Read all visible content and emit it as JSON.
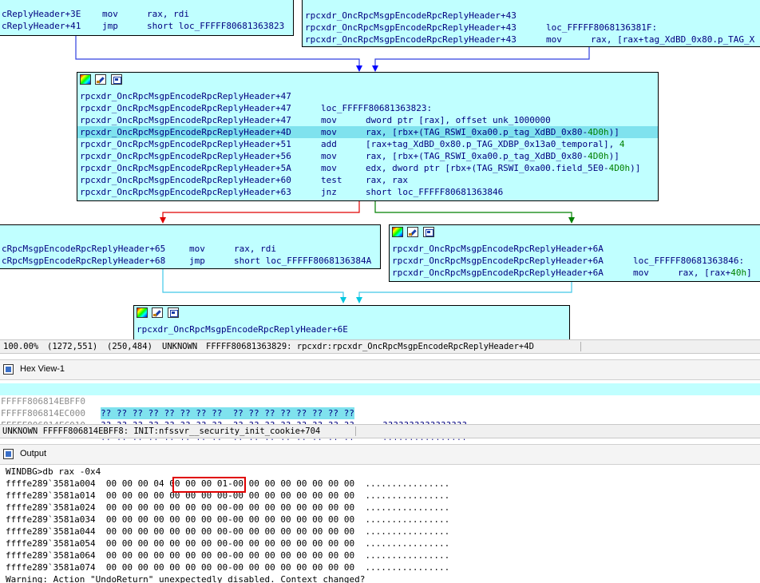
{
  "graph": {
    "node_top_left": [
      {
        "label": "cReplyHeader+3E",
        "mnem": "mov",
        "ops": "rax, rdi"
      },
      {
        "label": "cReplyHeader+41",
        "mnem": "jmp",
        "ops": "short loc_FFFFF80681363823"
      }
    ],
    "node_top_right": [
      {
        "label": "rpcxdr_OncRpcMsgpEncodeRpcReplyHeader+43",
        "mnem": "",
        "ops": ""
      },
      {
        "label": "rpcxdr_OncRpcMsgpEncodeRpcReplyHeader+43",
        "mnem": "loc_FFFFF8068136381F:",
        "ops": ""
      },
      {
        "label": "rpcxdr_OncRpcMsgpEncodeRpcReplyHeader+43",
        "mnem": "mov",
        "ops": "rax, [rax+tag_XdBD_0x80.p_TAG_X"
      }
    ],
    "node_main": [
      {
        "label": "rpcxdr_OncRpcMsgpEncodeRpcReplyHeader+47",
        "mnem": "",
        "ops": "",
        "num": ""
      },
      {
        "label": "rpcxdr_OncRpcMsgpEncodeRpcReplyHeader+47",
        "mnem": "loc_FFFFF80681363823:",
        "ops": "",
        "num": ""
      },
      {
        "label": "rpcxdr_OncRpcMsgpEncodeRpcReplyHeader+47",
        "mnem": "mov",
        "ops": "dword ptr [rax], offset unk_1000000",
        "num": ""
      },
      {
        "label": "rpcxdr_OncRpcMsgpEncodeRpcReplyHeader+4D",
        "mnem": "mov",
        "ops": "rax, [rbx+(TAG_RSWI_0xa00.p_tag_XdBD_0x80-",
        "num": "4D0h",
        "tail": ")]",
        "highlight": true
      },
      {
        "label": "rpcxdr_OncRpcMsgpEncodeRpcReplyHeader+51",
        "mnem": "add",
        "ops": "[rax+tag_XdBD_0x80.p_TAG_XDBP_0x13a0_temporal], ",
        "num": "4",
        "tail": ""
      },
      {
        "label": "rpcxdr_OncRpcMsgpEncodeRpcReplyHeader+56",
        "mnem": "mov",
        "ops": "rax, [rbx+(TAG_RSWI_0xa00.p_tag_XdBD_0x80-",
        "num": "4D0h",
        "tail": ")]"
      },
      {
        "label": "rpcxdr_OncRpcMsgpEncodeRpcReplyHeader+5A",
        "mnem": "mov",
        "ops": "edx, dword ptr [rbx+(TAG_RSWI_0xa00.field_5E0-",
        "num": "4D0h",
        "tail": ")]"
      },
      {
        "label": "rpcxdr_OncRpcMsgpEncodeRpcReplyHeader+60",
        "mnem": "test",
        "ops": "rax, rax",
        "num": ""
      },
      {
        "label": "rpcxdr_OncRpcMsgpEncodeRpcReplyHeader+63",
        "mnem": "jnz",
        "ops": "short loc_FFFFF80681363846",
        "num": ""
      }
    ],
    "node_left_mid": [
      {
        "label": "cRpcMsgpEncodeRpcReplyHeader+65",
        "mnem": "mov",
        "ops": "rax, rdi"
      },
      {
        "label": "cRpcMsgpEncodeRpcReplyHeader+68",
        "mnem": "jmp",
        "ops": "short loc_FFFFF8068136384A"
      }
    ],
    "node_right_mid": [
      {
        "label": "rpcxdr_OncRpcMsgpEncodeRpcReplyHeader+6A",
        "mnem": "",
        "ops": "",
        "num": ""
      },
      {
        "label": "rpcxdr_OncRpcMsgpEncodeRpcReplyHeader+6A",
        "mnem": "loc_FFFFF80681363846:",
        "ops": "",
        "num": ""
      },
      {
        "label": "rpcxdr_OncRpcMsgpEncodeRpcReplyHeader+6A",
        "mnem": "mov",
        "ops": "rax, [rax+",
        "num": "40h",
        "tail": "]"
      }
    ],
    "node_bottom": [
      {
        "label": "rpcxdr_OncRpcMsgpEncodeRpcReplyHeader+6E"
      }
    ]
  },
  "status_bar": {
    "zoom": "100.00%",
    "cursor": "(1272,551)",
    "pos": "(250,484)",
    "segment": "UNKNOWN",
    "location": "FFFFF80681363829: rpcxdr:rpcxdr_OncRpcMsgpEncodeRpcReplyHeader+4D"
  },
  "hex_view": {
    "title": "Hex View-1",
    "rows": [
      {
        "addr": "FFFFF806814EBFF0",
        "bytes": "?? ?? ?? ?? ?? ?? ?? ??  ?? ?? ?? ?? ?? ?? ?? ??",
        "ascii": "????????????????",
        "selected": true
      },
      {
        "addr": "FFFFF806814EC000",
        "bytes": "?? ?? ?? ?? ?? ?? ?? ??  ?? ?? ?? ?? ?? ?? ?? ??",
        "ascii": "????????????????"
      },
      {
        "addr": "FFFFF806814EC010",
        "bytes": "?? ?? ?? ?? ?? ?? ?? ??  ?? ?? ?? ?? ?? ?? ?? ??",
        "ascii": "????????????????"
      }
    ],
    "status": "UNKNOWN FFFFF806814EBFF8: INIT:nfssvr__security_init_cookie+704"
  },
  "output": {
    "title": "Output",
    "lines": [
      "WINDBG>db rax -0x4",
      "ffffe289`3581a004  00 00 00 04 00 00 00 01-00 00 00 00 00 00 00 00  ................",
      "ffffe289`3581a014  00 00 00 00 00 00 00 00-00 00 00 00 00 00 00 00  ................",
      "ffffe289`3581a024  00 00 00 00 00 00 00 00-00 00 00 00 00 00 00 00  ................",
      "ffffe289`3581a034  00 00 00 00 00 00 00 00-00 00 00 00 00 00 00 00  ................",
      "ffffe289`3581a044  00 00 00 00 00 00 00 00-00 00 00 00 00 00 00 00  ................",
      "ffffe289`3581a054  00 00 00 00 00 00 00 00-00 00 00 00 00 00 00 00  ................",
      "ffffe289`3581a064  00 00 00 00 00 00 00 00-00 00 00 00 00 00 00 00  ................",
      "ffffe289`3581a074  00 00 00 00 00 00 00 00-00 00 00 00 00 00 00 00  ................",
      "Warning: Action \"UndoReturn\" unexpectedly disabled. Context changed?"
    ]
  },
  "colors": {
    "node_bg": "#c0ffff",
    "highlight": "#7fe2ee",
    "edge_blue": "#0000ff",
    "edge_red": "#ff0000",
    "edge_green": "#008000",
    "edge_cyan": "#00c8e0",
    "annotation_red": "#e00000"
  }
}
